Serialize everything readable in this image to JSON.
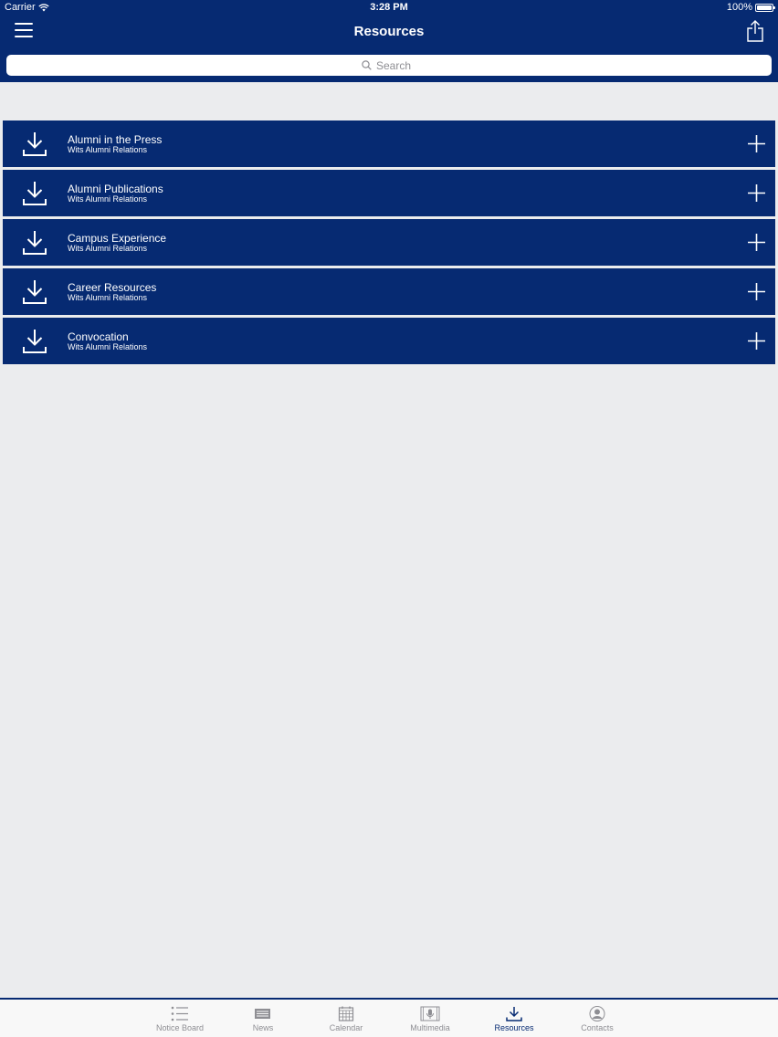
{
  "status_bar": {
    "carrier": "Carrier",
    "time": "3:28 PM",
    "battery": "100%"
  },
  "header": {
    "title": "Resources"
  },
  "search": {
    "placeholder": "Search"
  },
  "resources": [
    {
      "title": "Alumni in the Press",
      "subtitle": "Wits Alumni Relations"
    },
    {
      "title": "Alumni Publications",
      "subtitle": "Wits Alumni Relations"
    },
    {
      "title": "Campus Experience",
      "subtitle": "Wits Alumni Relations"
    },
    {
      "title": "Career Resources",
      "subtitle": "Wits Alumni Relations"
    },
    {
      "title": "Convocation",
      "subtitle": "Wits Alumni Relations"
    }
  ],
  "tabs": [
    {
      "label": "Notice Board",
      "icon": "list-icon"
    },
    {
      "label": "News",
      "icon": "newspaper-icon"
    },
    {
      "label": "Calendar",
      "icon": "calendar-icon"
    },
    {
      "label": "Multimedia",
      "icon": "microphone-icon"
    },
    {
      "label": "Resources",
      "icon": "download-icon",
      "active": true
    },
    {
      "label": "Contacts",
      "icon": "person-icon"
    }
  ],
  "colors": {
    "brand": "#062a72",
    "background": "#ebecee",
    "tab_inactive": "#8e8e93"
  }
}
